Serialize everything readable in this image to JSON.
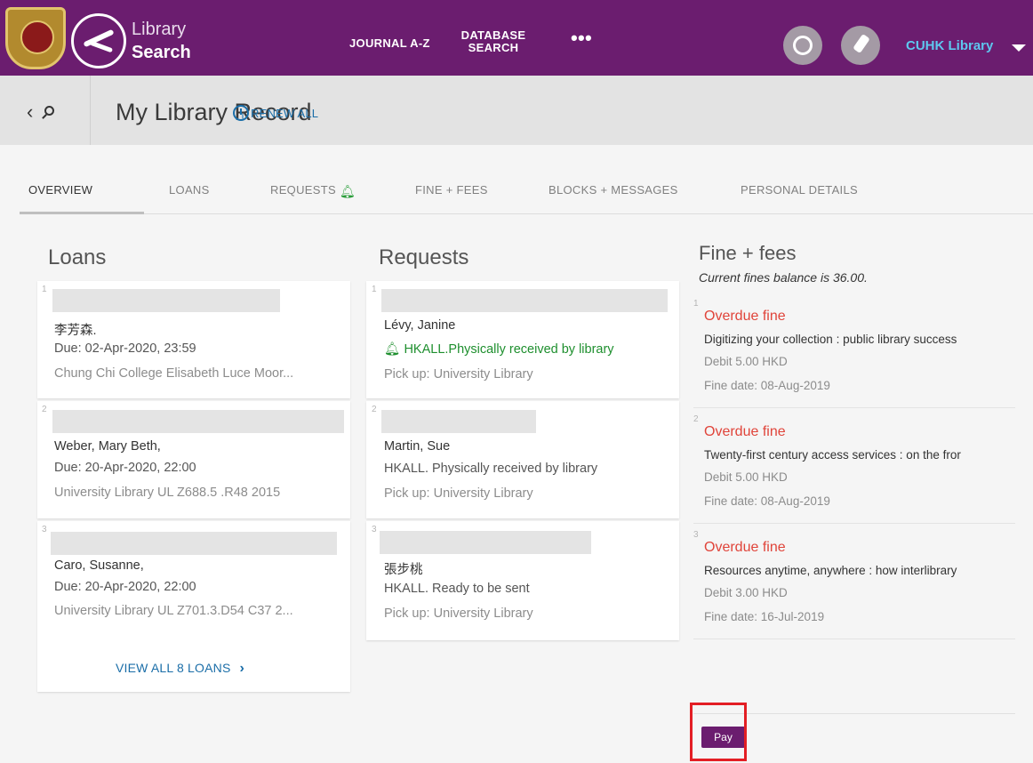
{
  "header": {
    "brand_top": "Library",
    "brand_bottom": "Search",
    "nav": [
      "JOURNAL A-Z",
      "DATABASE",
      "SEARCH",
      "•••"
    ],
    "account": "CUHK Library",
    "icons": [
      "cuhk-crest-logo",
      "library-search-logo",
      "history-icon",
      "pin-icon",
      "caret-down-icon"
    ]
  },
  "title_bar": {
    "title": "My Library Record",
    "icons": [
      "back-chevron-icon",
      "search-icon"
    ]
  },
  "tabs": [
    {
      "label": "OVERVIEW",
      "active": true
    },
    {
      "label": "LOANS"
    },
    {
      "label": "REQUESTS",
      "icon": "bell-icon"
    },
    {
      "label": "FINE + FEES"
    },
    {
      "label": "BLOCKS + MESSAGES"
    },
    {
      "label": "PERSONAL DETAILS"
    }
  ],
  "loans": {
    "title": "Loans",
    "renew_all": "RENEW ALL",
    "items": [
      {
        "num": "1",
        "author": "李芳森.",
        "due": "Due: 02-Apr-2020, 23:59",
        "location": "Chung Chi College Elisabeth Luce Moor..."
      },
      {
        "num": "2",
        "author": "Weber, Mary Beth,",
        "due": "Due: 20-Apr-2020, 22:00",
        "location": "University Library UL Z688.5 .R48 2015"
      },
      {
        "num": "3",
        "author": "Caro, Susanne,",
        "due": "Due: 20-Apr-2020, 22:00",
        "location": "University Library UL Z701.3.D54 C37 2..."
      }
    ],
    "view_all": "VIEW ALL 8 LOANS"
  },
  "requests": {
    "title": "Requests",
    "items": [
      {
        "num": "1",
        "author": "Lévy, Janine",
        "status": "HKALL.Physically received by library",
        "pickup": "Pick up: University Library"
      },
      {
        "num": "2",
        "author": "Martin, Sue",
        "status": "HKALL. Physically received by library",
        "pickup": "Pick up: University Library"
      },
      {
        "num": "3",
        "author": "張步桃",
        "status": "HKALL. Ready to be sent",
        "pickup": "Pick up: University Library"
      }
    ]
  },
  "fines": {
    "title": "Fine + fees",
    "balance": "Current fines balance is 36.00.",
    "items": [
      {
        "num": "1",
        "type": "Overdue fine",
        "title": "Digitizing your collection : public library success",
        "debit": "Debit 5.00 HKD",
        "date": "Fine date: 08-Aug-2019"
      },
      {
        "num": "2",
        "type": "Overdue fine",
        "title": "Twenty-first century access services : on the fror",
        "debit": "Debit 5.00 HKD",
        "date": "Fine date: 08-Aug-2019"
      },
      {
        "num": "3",
        "type": "Overdue fine",
        "title": "Resources anytime, anywhere : how interlibrary",
        "debit": "Debit 3.00 HKD",
        "date": "Fine date: 16-Jul-2019"
      }
    ],
    "pay": "Pay"
  },
  "colors": {
    "header_purple": "#6b1d6f",
    "link_blue": "#1b6ea8",
    "status_green": "#1e8f2e",
    "fine_red": "#e0443a",
    "highlight_red": "#e31e24",
    "account_blue": "#5ec7ef"
  }
}
